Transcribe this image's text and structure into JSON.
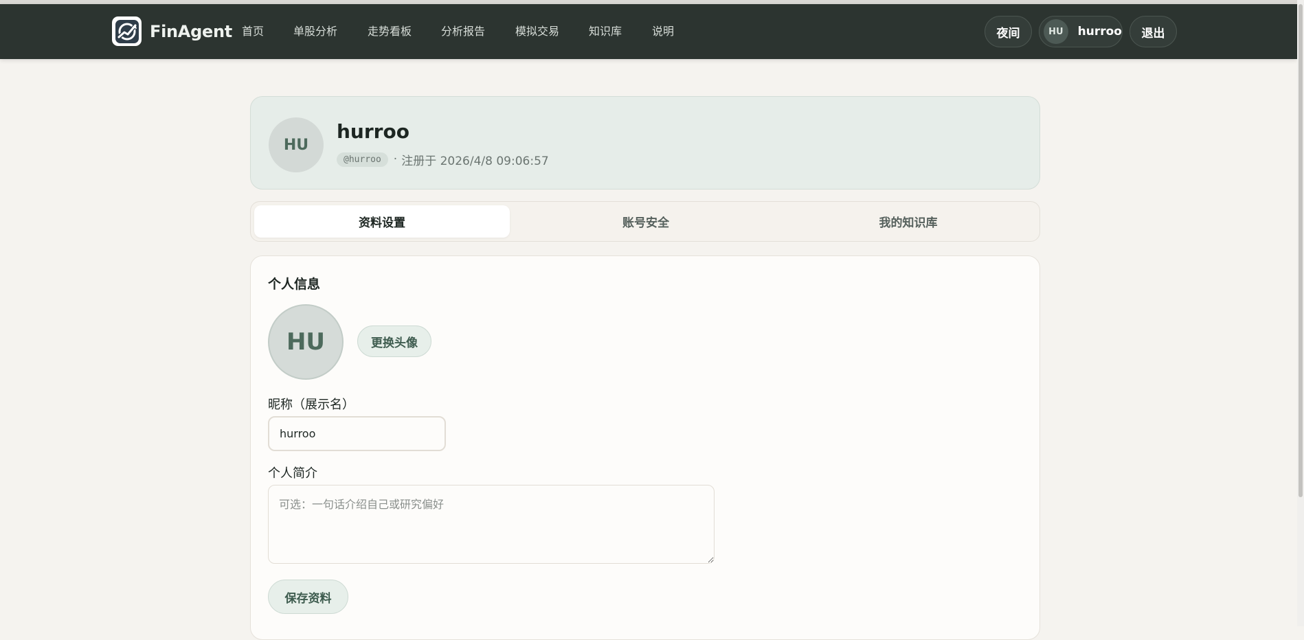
{
  "brand": {
    "name": "FinAgent"
  },
  "nav": {
    "items": [
      {
        "label": "首页"
      },
      {
        "label": "单股分析"
      },
      {
        "label": "走势看板"
      },
      {
        "label": "分析报告"
      },
      {
        "label": "模拟交易"
      },
      {
        "label": "知识库"
      },
      {
        "label": "说明"
      }
    ],
    "theme_label": "夜间",
    "user_initials": "HU",
    "user_name": "hurroo",
    "logout_label": "退出"
  },
  "profile": {
    "initials": "HU",
    "name": "hurroo",
    "handle": "@hurroo",
    "separator": "·",
    "registered": "注册于 2026/4/8 09:06:57"
  },
  "tabs": [
    {
      "label": "资料设置",
      "active": true
    },
    {
      "label": "账号安全",
      "active": false
    },
    {
      "label": "我的知识库",
      "active": false
    }
  ],
  "settings": {
    "section_title": "个人信息",
    "avatar_initials": "HU",
    "change_avatar_label": "更换头像",
    "nickname_label": "昵称（展示名）",
    "nickname_value": "hurroo",
    "bio_label": "个人简介",
    "bio_value": "",
    "bio_placeholder": "可选：一句话介绍自己或研究偏好",
    "save_label": "保存资料"
  },
  "colors": {
    "navbar": "#2c3430",
    "accent_green": "#3d5b4e",
    "page_bg": "#f5f3ef"
  }
}
